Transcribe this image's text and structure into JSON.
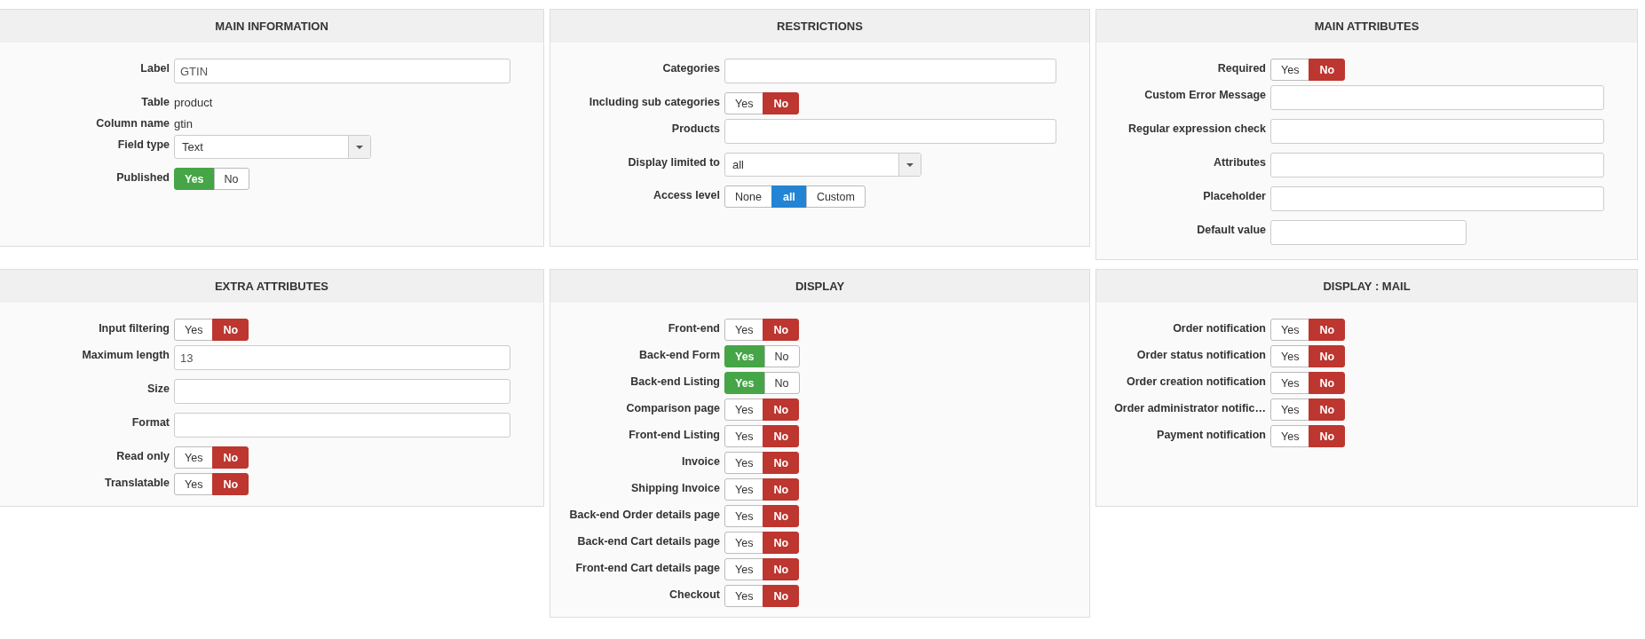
{
  "panels": [
    {
      "title": "MAIN INFORMATION",
      "rows": [
        {
          "kind": "text",
          "label": "Label",
          "value": "GTIN"
        },
        {
          "kind": "static",
          "label": "Table",
          "value": "product"
        },
        {
          "kind": "static",
          "label": "Column name",
          "value": "gtin"
        },
        {
          "kind": "select",
          "label": "Field type",
          "value": "Text"
        },
        {
          "kind": "toggle",
          "label": "Published",
          "options": [
            {
              "label": "Yes",
              "selected": true,
              "color": "#46a546"
            },
            {
              "label": "No",
              "selected": false
            }
          ]
        }
      ]
    },
    {
      "title": "RESTRICTIONS",
      "rows": [
        {
          "kind": "text",
          "label": "Categories"
        },
        {
          "kind": "toggle",
          "label": "Including sub categories",
          "options": [
            {
              "label": "Yes",
              "selected": false
            },
            {
              "label": "No",
              "selected": true,
              "color": "#bd362f"
            }
          ]
        },
        {
          "kind": "text",
          "label": "Products"
        },
        {
          "kind": "select",
          "label": "Display limited to",
          "value": "all"
        },
        {
          "kind": "toggle",
          "label": "Access level",
          "options": [
            {
              "label": "None",
              "selected": false
            },
            {
              "label": "all",
              "selected": true,
              "color": "#2384d3"
            },
            {
              "label": "Custom",
              "selected": false
            }
          ]
        }
      ]
    },
    {
      "title": "MAIN ATTRIBUTES",
      "rows": [
        {
          "kind": "toggle",
          "label": "Required",
          "options": [
            {
              "label": "Yes",
              "selected": false
            },
            {
              "label": "No",
              "selected": true,
              "color": "#bd362f"
            }
          ]
        },
        {
          "kind": "text",
          "label": "Custom Error Message"
        },
        {
          "kind": "text",
          "label": "Regular expression check"
        },
        {
          "kind": "text",
          "label": "Attributes"
        },
        {
          "kind": "text",
          "label": "Placeholder"
        },
        {
          "kind": "short-text",
          "label": "Default value"
        }
      ]
    },
    {
      "title": "EXTRA ATTRIBUTES",
      "rows": [
        {
          "kind": "toggle",
          "label": "Input filtering",
          "options": [
            {
              "label": "Yes",
              "selected": false
            },
            {
              "label": "No",
              "selected": true,
              "color": "#bd362f"
            }
          ]
        },
        {
          "kind": "text",
          "label": "Maximum length",
          "value": "13"
        },
        {
          "kind": "text",
          "label": "Size"
        },
        {
          "kind": "text",
          "label": "Format"
        },
        {
          "kind": "toggle",
          "label": "Read only",
          "options": [
            {
              "label": "Yes",
              "selected": false
            },
            {
              "label": "No",
              "selected": true,
              "color": "#bd362f"
            }
          ]
        },
        {
          "kind": "toggle",
          "label": "Translatable",
          "options": [
            {
              "label": "Yes",
              "selected": false
            },
            {
              "label": "No",
              "selected": true,
              "color": "#bd362f"
            }
          ]
        }
      ]
    },
    {
      "title": "DISPLAY",
      "rows": [
        {
          "kind": "toggle",
          "label": "Front-end",
          "options": [
            {
              "label": "Yes",
              "selected": false
            },
            {
              "label": "No",
              "selected": true,
              "color": "#bd362f"
            }
          ]
        },
        {
          "kind": "toggle",
          "label": "Back-end Form",
          "options": [
            {
              "label": "Yes",
              "selected": true,
              "color": "#46a546"
            },
            {
              "label": "No",
              "selected": false
            }
          ]
        },
        {
          "kind": "toggle",
          "label": "Back-end Listing",
          "options": [
            {
              "label": "Yes",
              "selected": true,
              "color": "#46a546"
            },
            {
              "label": "No",
              "selected": false
            }
          ]
        },
        {
          "kind": "toggle",
          "label": "Comparison page",
          "options": [
            {
              "label": "Yes",
              "selected": false
            },
            {
              "label": "No",
              "selected": true,
              "color": "#bd362f"
            }
          ]
        },
        {
          "kind": "toggle",
          "label": "Front-end Listing",
          "options": [
            {
              "label": "Yes",
              "selected": false
            },
            {
              "label": "No",
              "selected": true,
              "color": "#bd362f"
            }
          ]
        },
        {
          "kind": "toggle",
          "label": "Invoice",
          "options": [
            {
              "label": "Yes",
              "selected": false
            },
            {
              "label": "No",
              "selected": true,
              "color": "#bd362f"
            }
          ]
        },
        {
          "kind": "toggle",
          "label": "Shipping Invoice",
          "options": [
            {
              "label": "Yes",
              "selected": false
            },
            {
              "label": "No",
              "selected": true,
              "color": "#bd362f"
            }
          ]
        },
        {
          "kind": "toggle",
          "label": "Back-end Order details page",
          "options": [
            {
              "label": "Yes",
              "selected": false
            },
            {
              "label": "No",
              "selected": true,
              "color": "#bd362f"
            }
          ]
        },
        {
          "kind": "toggle",
          "label": "Back-end Cart details page",
          "options": [
            {
              "label": "Yes",
              "selected": false
            },
            {
              "label": "No",
              "selected": true,
              "color": "#bd362f"
            }
          ]
        },
        {
          "kind": "toggle",
          "label": "Front-end Cart details page",
          "options": [
            {
              "label": "Yes",
              "selected": false
            },
            {
              "label": "No",
              "selected": true,
              "color": "#bd362f"
            }
          ]
        },
        {
          "kind": "toggle",
          "label": "Checkout",
          "options": [
            {
              "label": "Yes",
              "selected": false
            },
            {
              "label": "No",
              "selected": true,
              "color": "#bd362f"
            }
          ]
        }
      ]
    },
    {
      "title": "DISPLAY : MAIL",
      "rows": [
        {
          "kind": "toggle",
          "label": "Order notification",
          "options": [
            {
              "label": "Yes",
              "selected": false
            },
            {
              "label": "No",
              "selected": true,
              "color": "#bd362f"
            }
          ]
        },
        {
          "kind": "toggle",
          "label": "Order status notification",
          "options": [
            {
              "label": "Yes",
              "selected": false
            },
            {
              "label": "No",
              "selected": true,
              "color": "#bd362f"
            }
          ]
        },
        {
          "kind": "toggle",
          "label": "Order creation notification",
          "options": [
            {
              "label": "Yes",
              "selected": false
            },
            {
              "label": "No",
              "selected": true,
              "color": "#bd362f"
            }
          ]
        },
        {
          "kind": "toggle",
          "label": "Order administrator notific…",
          "options": [
            {
              "label": "Yes",
              "selected": false
            },
            {
              "label": "No",
              "selected": true,
              "color": "#bd362f"
            }
          ]
        },
        {
          "kind": "toggle",
          "label": "Payment notification",
          "options": [
            {
              "label": "Yes",
              "selected": false
            },
            {
              "label": "No",
              "selected": true,
              "color": "#bd362f"
            }
          ]
        }
      ]
    }
  ]
}
